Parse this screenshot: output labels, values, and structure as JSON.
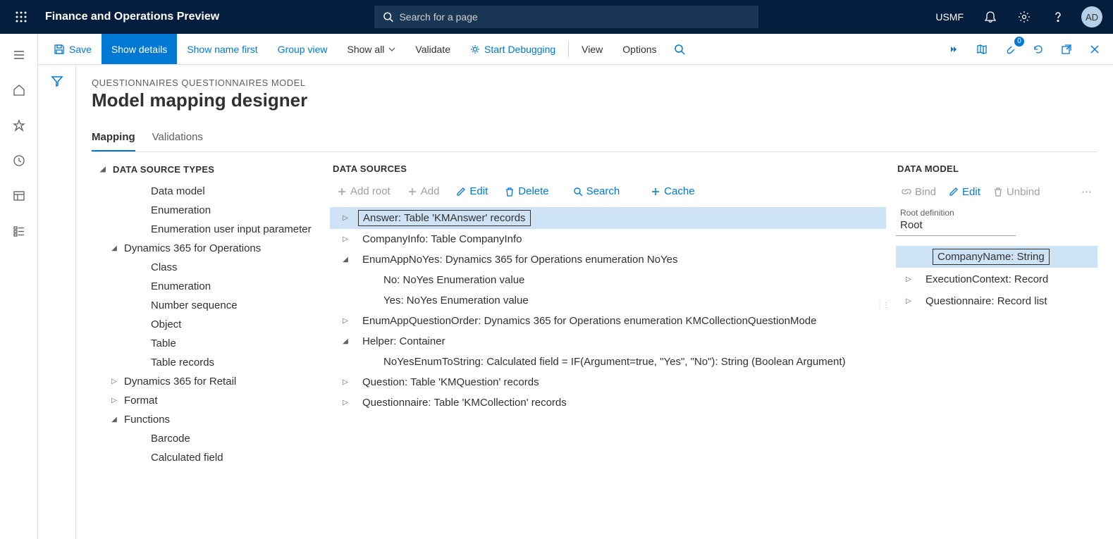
{
  "header": {
    "app_title": "Finance and Operations Preview",
    "search_placeholder": "Search for a page",
    "company": "USMF",
    "avatar": "AD"
  },
  "actionbar": {
    "save": "Save",
    "show_details": "Show details",
    "show_name_first": "Show name first",
    "group_view": "Group view",
    "show_all": "Show all",
    "validate": "Validate",
    "start_debugging": "Start Debugging",
    "view": "View",
    "options": "Options",
    "badge_count": "0"
  },
  "page": {
    "breadcrumb": "QUESTIONNAIRES QUESTIONNAIRES MODEL",
    "title": "Model mapping designer",
    "tabs": {
      "mapping": "Mapping",
      "validations": "Validations"
    }
  },
  "col1": {
    "header": "DATA SOURCE TYPES",
    "items": [
      {
        "label": "Data model",
        "indent": 3,
        "expander": ""
      },
      {
        "label": "Enumeration",
        "indent": 3,
        "expander": ""
      },
      {
        "label": "Enumeration user input parameter",
        "indent": 3,
        "expander": ""
      },
      {
        "label": "Dynamics 365 for Operations",
        "indent": 2,
        "expander": "down"
      },
      {
        "label": "Class",
        "indent": 3,
        "expander": ""
      },
      {
        "label": "Enumeration",
        "indent": 3,
        "expander": ""
      },
      {
        "label": "Number sequence",
        "indent": 3,
        "expander": ""
      },
      {
        "label": "Object",
        "indent": 3,
        "expander": ""
      },
      {
        "label": "Table",
        "indent": 3,
        "expander": ""
      },
      {
        "label": "Table records",
        "indent": 3,
        "expander": ""
      },
      {
        "label": "Dynamics 365 for Retail",
        "indent": 2,
        "expander": "right"
      },
      {
        "label": "Format",
        "indent": 2,
        "expander": "right"
      },
      {
        "label": "Functions",
        "indent": 2,
        "expander": "down"
      },
      {
        "label": "Barcode",
        "indent": 3,
        "expander": ""
      },
      {
        "label": "Calculated field",
        "indent": 3,
        "expander": ""
      }
    ]
  },
  "col2": {
    "header": "DATA SOURCES",
    "tools": {
      "add_root": "Add root",
      "add": "Add",
      "edit": "Edit",
      "delete": "Delete",
      "search": "Search",
      "cache": "Cache"
    },
    "rows": [
      {
        "label": "Answer: Table 'KMAnswer' records",
        "indent": 1,
        "expander": "right",
        "selected": true,
        "boxed": true
      },
      {
        "label": "CompanyInfo: Table CompanyInfo",
        "indent": 1,
        "expander": "right"
      },
      {
        "label": "EnumAppNoYes: Dynamics 365 for Operations enumeration NoYes",
        "indent": 1,
        "expander": "down"
      },
      {
        "label": "No: NoYes Enumeration value",
        "indent": 2,
        "expander": ""
      },
      {
        "label": "Yes: NoYes Enumeration value",
        "indent": 2,
        "expander": ""
      },
      {
        "label": "EnumAppQuestionOrder: Dynamics 365 for Operations enumeration KMCollectionQuestionMode",
        "indent": 1,
        "expander": "right"
      },
      {
        "label": "Helper: Container",
        "indent": 1,
        "expander": "down"
      },
      {
        "label": "NoYesEnumToString: Calculated field = IF(Argument=true, \"Yes\", \"No\"): String (Boolean Argument)",
        "indent": 2,
        "expander": ""
      },
      {
        "label": "Question: Table 'KMQuestion' records",
        "indent": 1,
        "expander": "right"
      },
      {
        "label": "Questionnaire: Table 'KMCollection' records",
        "indent": 1,
        "expander": "right"
      }
    ]
  },
  "col3": {
    "header": "DATA MODEL",
    "tools": {
      "bind": "Bind",
      "edit": "Edit",
      "unbind": "Unbind"
    },
    "root_label": "Root definition",
    "root_value": "Root",
    "rows": [
      {
        "label": "CompanyName: String",
        "expander": "",
        "selected": true,
        "boxed": true
      },
      {
        "label": "ExecutionContext: Record",
        "expander": "right"
      },
      {
        "label": "Questionnaire: Record list",
        "expander": "right"
      }
    ]
  }
}
